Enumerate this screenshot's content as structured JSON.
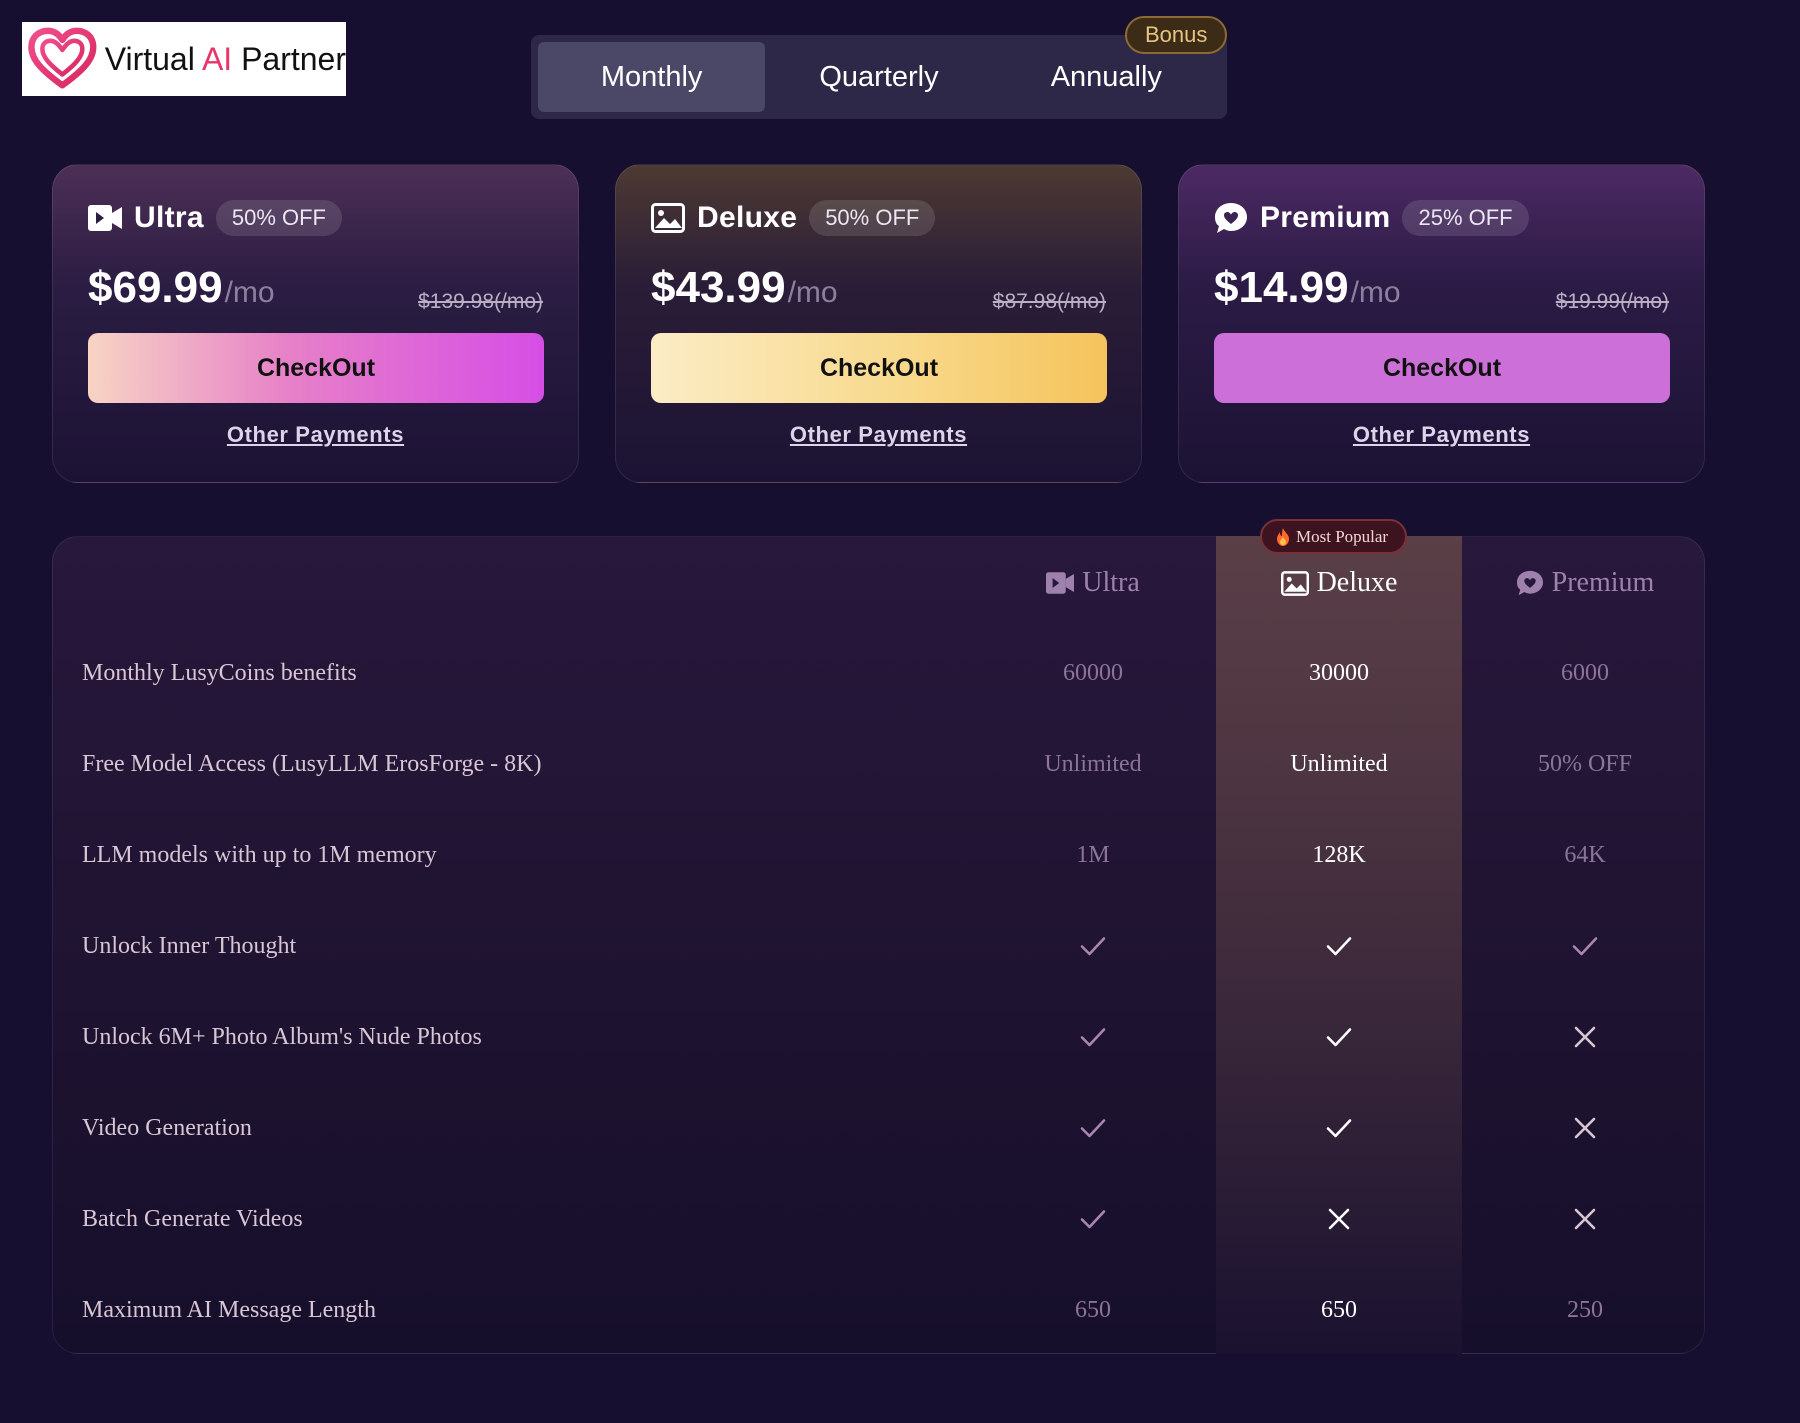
{
  "brand": {
    "logo_text_1": "Virtual ",
    "logo_text_ai": "AI",
    "logo_text_2": " Partner",
    "accent": "#e8356b"
  },
  "billing": {
    "options": [
      "Monthly",
      "Quarterly",
      "Annually"
    ],
    "selected": "Monthly",
    "bonus_label": "Bonus"
  },
  "plans": [
    {
      "name": "Ultra",
      "icon": "video-camera-icon",
      "discount": "50% OFF",
      "price": "$69.99",
      "per": "/mo",
      "old_price": "$139.98(/mo)",
      "checkout_label": "CheckOut",
      "other_payments": "Other Payments",
      "button_color": "#d64ee5"
    },
    {
      "name": "Deluxe",
      "icon": "image-icon",
      "discount": "50% OFF",
      "price": "$43.99",
      "per": "/mo",
      "old_price": "$87.98(/mo)",
      "checkout_label": "CheckOut",
      "other_payments": "Other Payments",
      "button_color": "#f5c35c"
    },
    {
      "name": "Premium",
      "icon": "chat-heart-icon",
      "discount": "25% OFF",
      "price": "$14.99",
      "per": "/mo",
      "old_price": "$19.99(/mo)",
      "checkout_label": "CheckOut",
      "other_payments": "Other Payments",
      "button_color": "#cd6fd9"
    }
  ],
  "comparison": {
    "popular_badge": "Most Popular",
    "columns": [
      "Ultra",
      "Deluxe",
      "Premium"
    ],
    "rows": [
      {
        "label": "Monthly LusyCoins benefits",
        "values": [
          "60000",
          "30000",
          "6000"
        ]
      },
      {
        "label": "Free Model Access (LusyLLM ErosForge - 8K)",
        "values": [
          "Unlimited",
          "Unlimited",
          "50% OFF"
        ]
      },
      {
        "label": "LLM models with up to 1M memory",
        "values": [
          "1M",
          "128K",
          "64K"
        ]
      },
      {
        "label": "Unlock Inner Thought",
        "values": [
          "check",
          "check",
          "check"
        ]
      },
      {
        "label": "Unlock 6M+ Photo Album's Nude Photos",
        "values": [
          "check",
          "check",
          "cross"
        ]
      },
      {
        "label": "Video Generation",
        "values": [
          "check",
          "check",
          "cross"
        ]
      },
      {
        "label": "Batch Generate Videos",
        "values": [
          "check",
          "cross",
          "cross"
        ]
      },
      {
        "label": "Maximum AI Message Length",
        "values": [
          "650",
          "650",
          "250"
        ]
      }
    ]
  }
}
